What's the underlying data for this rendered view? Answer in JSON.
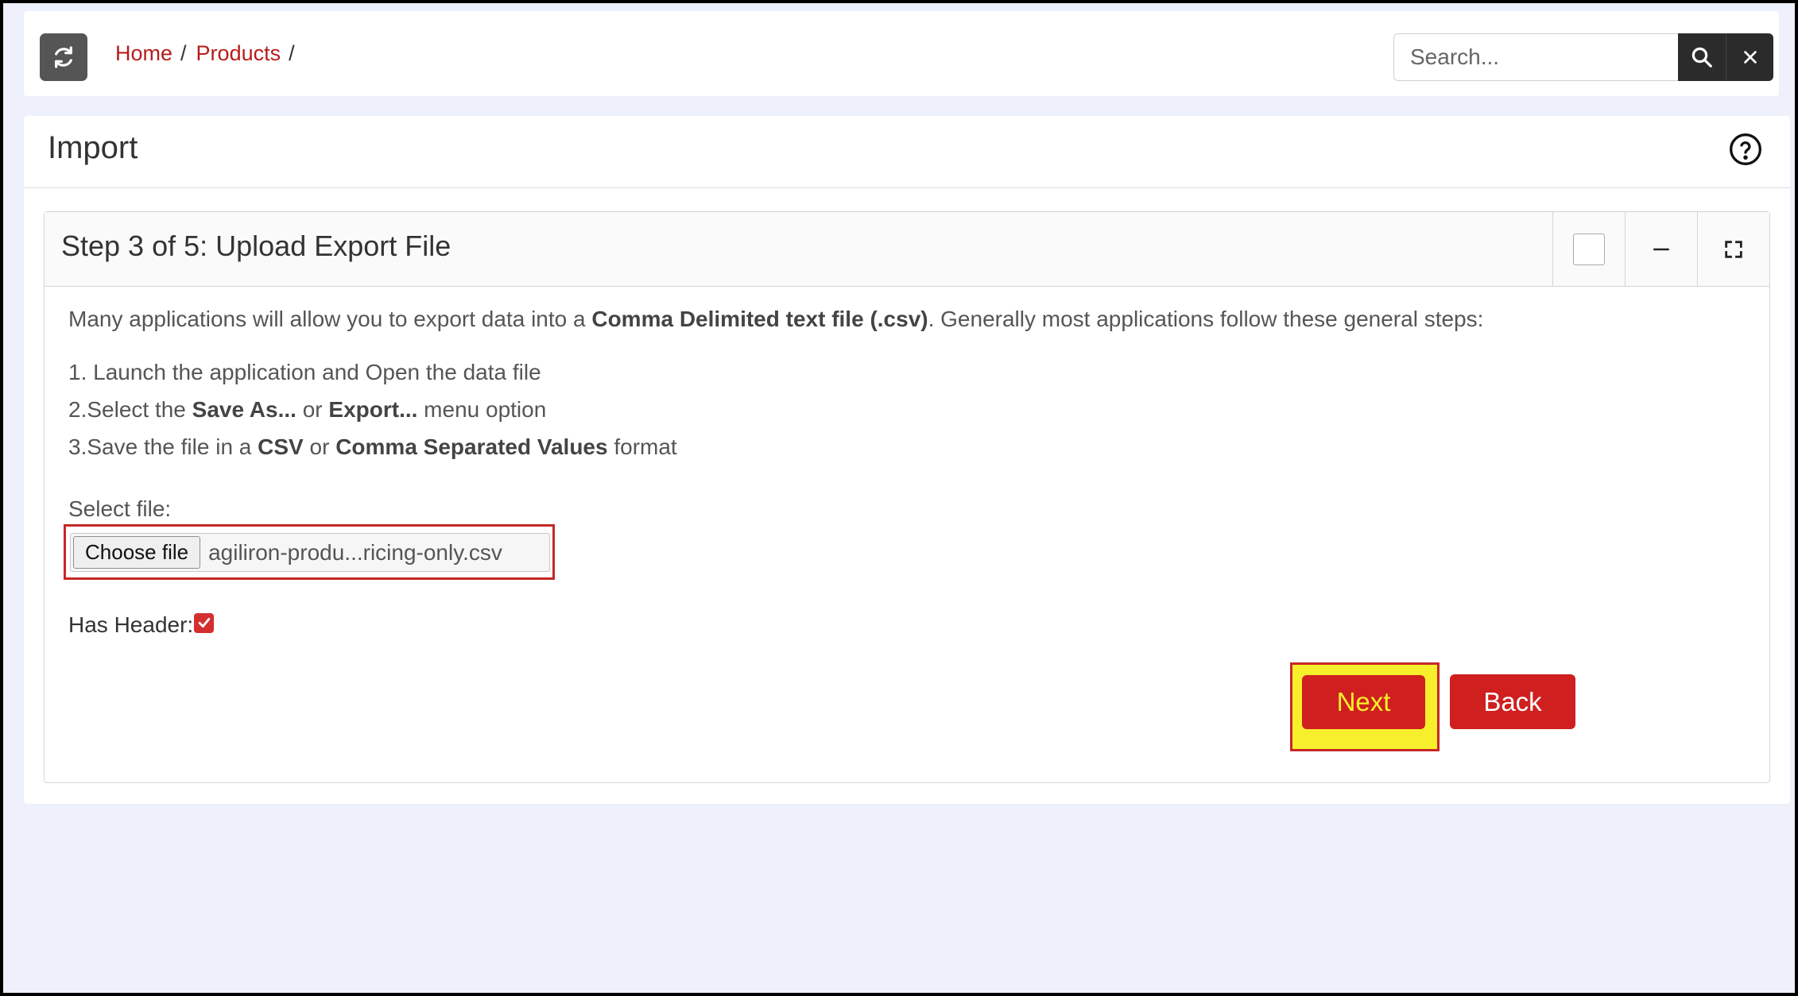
{
  "topbar": {
    "refresh_icon": "refresh-icon",
    "breadcrumb": [
      {
        "label": "Home"
      },
      {
        "label": "Products"
      }
    ],
    "breadcrumb_separator": "/",
    "search": {
      "placeholder": "Search...",
      "value": ""
    },
    "search_icon": "search-icon",
    "clear_icon": "close-icon"
  },
  "panel": {
    "title": "Import",
    "help_icon": "question-circle-icon"
  },
  "card": {
    "title": "Step 3 of 5: Upload Export File",
    "tools": [
      "checkbox",
      "minimize-icon",
      "expand-icon"
    ],
    "intro": {
      "before": "Many applications will allow you to export data into a ",
      "bold": "Comma Delimited text file (.csv)",
      "after": ". Generally most applications follow these general steps:"
    },
    "steps": {
      "s1": "1. Launch the application and Open the data file",
      "s2_a": "2.Select the ",
      "s2_b": "Save As...",
      "s2_c": " or ",
      "s2_d": "Export...",
      "s2_e": " menu option",
      "s3_a": "3.Save the file in a ",
      "s3_b": "CSV",
      "s3_c": " or ",
      "s3_d": "Comma Separated Values",
      "s3_e": " format"
    },
    "select_file_label": "Select file:",
    "choose_file_label": "Choose file",
    "file_name": "agiliron-produ...ricing-only.csv",
    "has_header_label": "Has Header:",
    "has_header_checked": true,
    "next_label": "Next",
    "back_label": "Back"
  },
  "colors": {
    "accent_red": "#cf1f1f",
    "highlight_yellow": "#f8ef2c",
    "link_red": "#b71c1c",
    "dark_button": "#2b2b2b"
  }
}
